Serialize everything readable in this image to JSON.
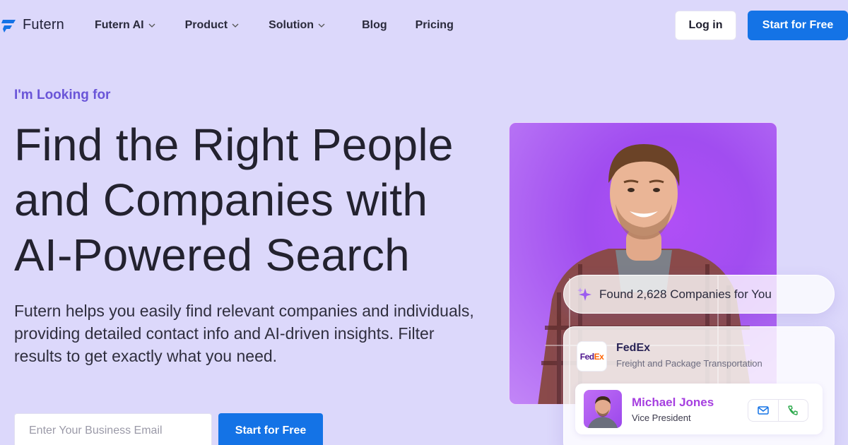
{
  "brand": {
    "name": "Futern",
    "accent": "#1473e6",
    "purple": "#6a55d8"
  },
  "nav": {
    "items": [
      {
        "label": "Futern AI",
        "dropdown": true
      },
      {
        "label": "Product",
        "dropdown": true
      },
      {
        "label": "Solution",
        "dropdown": true
      },
      {
        "label": "Blog",
        "dropdown": false
      },
      {
        "label": "Pricing",
        "dropdown": false
      }
    ],
    "login_label": "Log in",
    "start_label": "Start for Free"
  },
  "hero": {
    "eyebrow": "I'm Looking for",
    "headline_lines": [
      "Find the Right People",
      "and Companies with",
      "AI-Powered Search"
    ],
    "subtext_lines": [
      "Futern helps you easily find relevant companies and individuals,",
      "providing detailed contact info and AI-driven insights. Filter",
      "results to get exactly what you need."
    ],
    "email_placeholder": "Enter Your Business Email",
    "cta_label": "Start for Free"
  },
  "visual": {
    "found_text": "Found 2,628 Companies for You",
    "company": {
      "logo_fed": "Fed",
      "logo_ex": "Ex",
      "name": "FedEx",
      "description": "Freight and Package Transportation"
    },
    "contact": {
      "name": "Michael Jones",
      "title": "Vice President",
      "icons": [
        "mail-icon",
        "phone-icon"
      ]
    }
  }
}
